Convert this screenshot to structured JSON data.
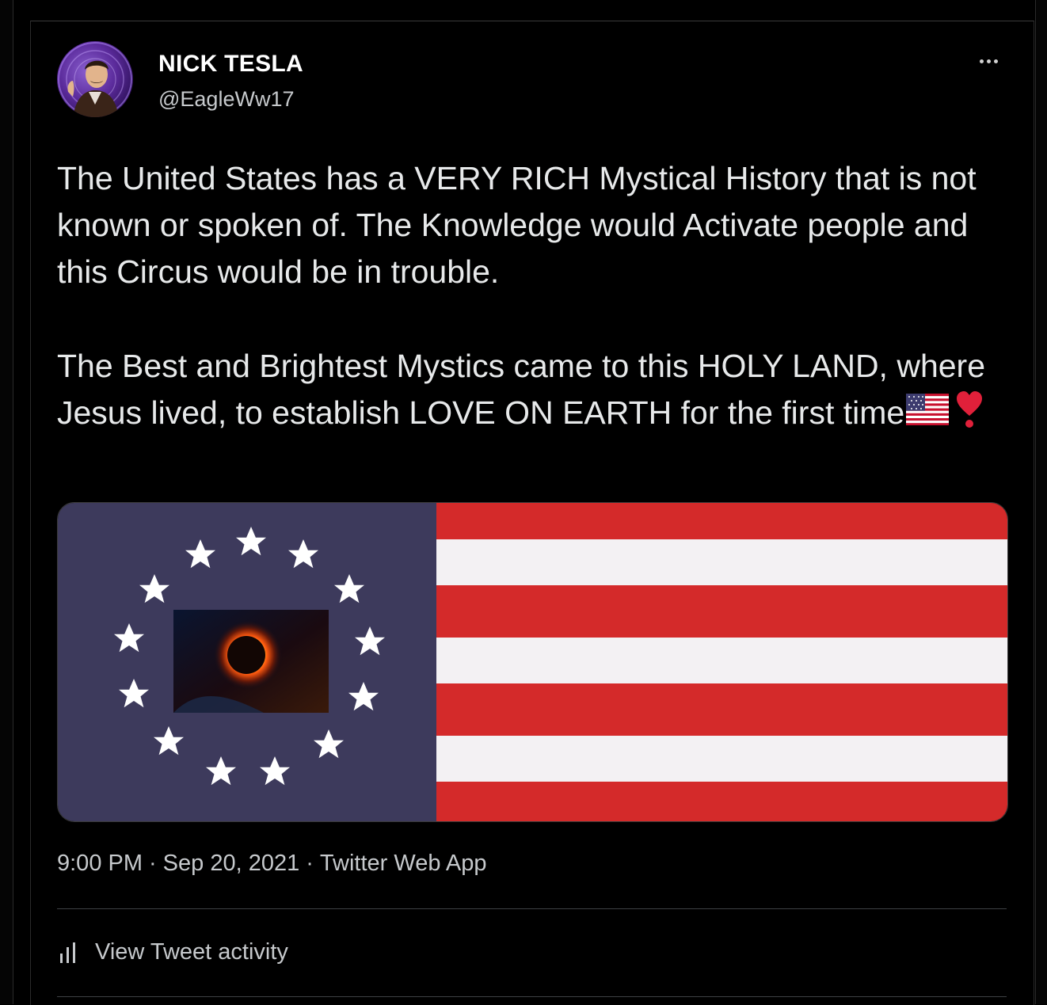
{
  "tweet": {
    "author": {
      "display_name": "NICK TESLA",
      "handle": "@EagleWw17"
    },
    "text_paragraph_1": "The United States has a VERY RICH Mystical History that is not known or spoken of. The Knowledge would Activate people and this Circus would be in trouble.",
    "text_paragraph_2": "The Best and Brightest Mystics came to this HOLY LAND, where Jesus lived, to establish LOVE ON EARTH for the first time",
    "emojis": [
      "us-flag-emoji",
      "red-exclamation-heart-emoji"
    ],
    "media": {
      "description_icon": "flag-image",
      "colors": {
        "canton": "#3d3a5c",
        "red_stripe": "#d42a2a",
        "white_stripe": "#f3f1f3"
      }
    },
    "time": "9:00 PM",
    "date": "Sep 20, 2021",
    "source": "Twitter Web App",
    "separator": "·",
    "activity_label": "View Tweet activity"
  },
  "colors": {
    "background": "#000000",
    "text": "#e7e9ea",
    "secondary_text": "#c6c9cc",
    "divider": "#3e4144"
  }
}
